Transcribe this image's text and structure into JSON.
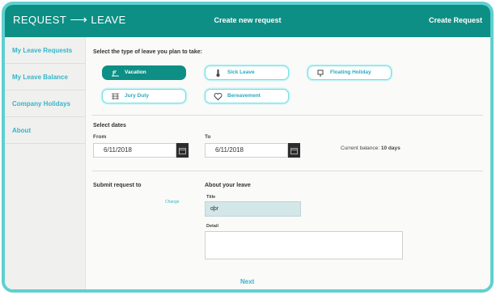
{
  "header": {
    "brand_left": "REQUEST",
    "brand_arrow": "⟶",
    "brand_right": "LEAVE",
    "title": "Create new request",
    "right_label": "Create Request"
  },
  "sidebar": {
    "items": [
      {
        "label": "My Leave Requests"
      },
      {
        "label": "My Leave Balance"
      },
      {
        "label": "Company Holidays"
      },
      {
        "label": "About"
      }
    ]
  },
  "leave_type": {
    "prompt": "Select the type of leave you plan to take:",
    "options": [
      {
        "label": "Vacation",
        "icon": "beach-icon",
        "selected": true
      },
      {
        "label": "Sick Leave",
        "icon": "thermometer-icon",
        "selected": false
      },
      {
        "label": "Floating Holiday",
        "icon": "floating-icon",
        "selected": false
      },
      {
        "label": "Jury Duty",
        "icon": "jury-icon",
        "selected": false
      },
      {
        "label": "Bereavement",
        "icon": "heart-icon",
        "selected": false
      }
    ]
  },
  "dates": {
    "heading": "Select dates",
    "from_label": "From",
    "from_value": "6/11/2018",
    "to_label": "To",
    "to_value": "6/11/2018",
    "balance_label": "Current balance:",
    "balance_value": "10 days"
  },
  "submit": {
    "heading": "Submit request to",
    "change_label": "Change"
  },
  "about": {
    "heading": "About your leave",
    "title_label": "Title",
    "title_value": "ɑþr",
    "detail_label": "Detail",
    "detail_value": ""
  },
  "footer": {
    "next_label": "Next"
  },
  "colors": {
    "accent": "#0e8f85",
    "link": "#35b5c9",
    "frame": "#5fd0cf"
  }
}
